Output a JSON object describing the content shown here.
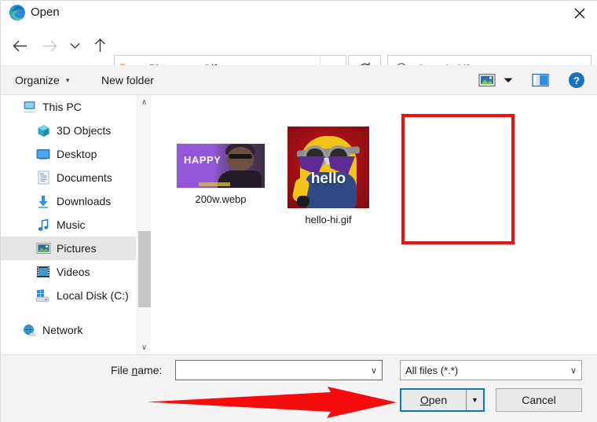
{
  "window": {
    "title": "Open",
    "app_icon": "edge-logo-icon",
    "close_label": "✕"
  },
  "nav": {
    "back_icon": "back-arrow-icon",
    "forward_icon": "forward-arrow-icon",
    "recent_icon": "chevron-down-icon",
    "up_icon": "up-arrow-icon",
    "refresh_icon": "refresh-icon",
    "breadcrumb": {
      "folder_icon": "folder-icon",
      "overflow": "«",
      "crumbs": [
        "Pictures",
        "Gifs"
      ],
      "separator": "›",
      "dropdown_icon": "chevron-down-icon"
    },
    "search": {
      "icon": "search-icon",
      "placeholder": "Search Gifs",
      "value": ""
    }
  },
  "command_bar": {
    "organize_label": "Organize",
    "organize_caret": "▾",
    "new_folder_label": "New folder",
    "view_icon": "view-layout-icon",
    "view_caret": "▾",
    "preview_pane_icon": "preview-pane-icon",
    "help_icon": "help-icon",
    "help_glyph": "?"
  },
  "sidebar": {
    "items": [
      {
        "label": "This PC",
        "icon": "this-pc-icon",
        "indent": 0,
        "selected": false
      },
      {
        "label": "3D Objects",
        "icon": "3d-objects-icon",
        "indent": 1,
        "selected": false
      },
      {
        "label": "Desktop",
        "icon": "desktop-icon",
        "indent": 1,
        "selected": false
      },
      {
        "label": "Documents",
        "icon": "documents-icon",
        "indent": 1,
        "selected": false
      },
      {
        "label": "Downloads",
        "icon": "downloads-icon",
        "indent": 1,
        "selected": false
      },
      {
        "label": "Music",
        "icon": "music-icon",
        "indent": 1,
        "selected": false
      },
      {
        "label": "Pictures",
        "icon": "pictures-icon",
        "indent": 1,
        "selected": true
      },
      {
        "label": "Videos",
        "icon": "videos-icon",
        "indent": 1,
        "selected": false
      },
      {
        "label": "Local Disk (C:)",
        "icon": "local-disk-icon",
        "indent": 1,
        "selected": false
      },
      {
        "label": "Network",
        "icon": "network-icon",
        "indent": 0,
        "selected": false
      }
    ],
    "scrollbar": {
      "up_arrow": "∧",
      "down_arrow": "∨"
    }
  },
  "file_pane": {
    "files": [
      {
        "name": "200w.webp",
        "thumb_text": "HAPPY",
        "selected": false
      },
      {
        "name": "hello-hi.gif",
        "thumb_text": "hello",
        "selected": true
      }
    ]
  },
  "footer": {
    "file_name_label_pre": "File ",
    "file_name_label_accel": "n",
    "file_name_label_post": "ame:",
    "file_name_value": "",
    "file_name_caret": "∨",
    "file_type_value": "All files (*.*)",
    "file_type_caret": "∨",
    "open_label_accel": "O",
    "open_label_rest": "pen",
    "open_split_caret": "▼",
    "cancel_label": "Cancel"
  },
  "annotations": {
    "arrow_color": "#f50c0c",
    "highlight_color": "#f01010",
    "arrow_target": "open-button",
    "highlight_target": "hello-hi.gif"
  },
  "colors": {
    "accent_blue": "#0a7ab4",
    "chrome_gray": "#f3f3f3",
    "selection_gray": "#e5e5e5",
    "annotation_red": "#f01010"
  }
}
